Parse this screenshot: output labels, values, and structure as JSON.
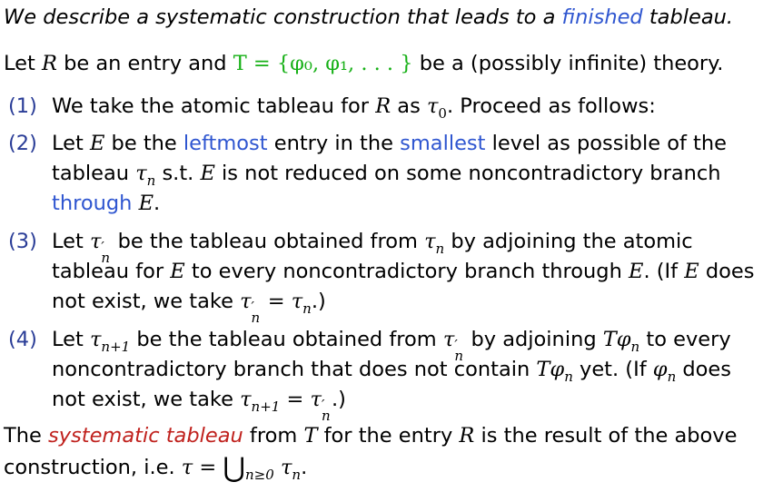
{
  "colors": {
    "text": "#000000",
    "highlight_blue": "#2f56d0",
    "highlight_green": "#16b016",
    "highlight_red": "#c0221e",
    "enum_number": "#2a3d97"
  },
  "intro": {
    "before": "We describe a systematic construction that leads to a ",
    "highlight": "finished",
    "after": " tableau."
  },
  "premise": {
    "let": "Let ",
    "entry_var": "R",
    "mid": " be an entry and ",
    "theory": "T = {φ₀, φ₁, . . . }",
    "after": " be a (possibly infinite) theory."
  },
  "steps": [
    {
      "number": "(1)",
      "text_a": "We take the atomic tableau for ",
      "var_R": "R",
      "text_b": " as ",
      "tau": "τ",
      "tau_sub": "0",
      "text_c": ". Proceed as follows:"
    },
    {
      "number": "(2)",
      "line1_a": "Let ",
      "line1_E": "E",
      "line1_b": " be the ",
      "line1_hl1": "leftmost",
      "line1_c": " entry in the ",
      "line1_hl2": "smallest",
      "line1_d": " level as possible of the",
      "line2_a": "tableau ",
      "line2_tau": "τ",
      "line2_sub": "n",
      "line2_b": " s.t. ",
      "line2_E": "E",
      "line2_c": " is not reduced on some noncontradictory branch",
      "line3_hl": "through",
      "line3_E": "E",
      "line3_end": "."
    },
    {
      "number": "(3)",
      "line1_a": "Let ",
      "line1_tau": "τ",
      "line1_prime": "′",
      "line1_sub": "n",
      "line1_b": " be the tableau obtained from ",
      "line1_tau2": "τ",
      "line1_sub2": "n",
      "line1_c": " by adjoining the atomic",
      "line2_a": "tableau for ",
      "line2_E": "E",
      "line2_b": " to every noncontradictory branch through ",
      "line2_E2": "E",
      "line2_c": ". (If ",
      "line2_E3": "E",
      "line2_d": " does",
      "line3_a": "not exist, we take ",
      "line3_tau": "τ",
      "line3_prime": "′",
      "line3_sub": "n",
      "line3_eq": " = ",
      "line3_tau2": "τ",
      "line3_sub2": "n",
      "line3_end": ".)"
    },
    {
      "number": "(4)",
      "line1_a": "Let ",
      "line1_tau": "τ",
      "line1_sub": "n+1",
      "line1_b": " be the tableau obtained from ",
      "line1_tau2": "τ",
      "line1_prime": "′",
      "line1_sub2": "n",
      "line1_c": " by adjoining ",
      "line1_T": "T",
      "line1_phi": "φ",
      "line1_phisub": "n",
      "line1_d": " to every",
      "line2_a": "noncontradictory branch that does not contain ",
      "line2_T": "T",
      "line2_phi": "φ",
      "line2_phisub": "n",
      "line2_b": " yet. (If ",
      "line2_phi2": "φ",
      "line2_phisub2": "n",
      "line2_c": " does",
      "line3_a": "not exist, we take ",
      "line3_tau": "τ",
      "line3_sub": "n+1",
      "line3_eq": " = ",
      "line3_tau2": "τ",
      "line3_prime": "′",
      "line3_sub2": "n",
      "line3_end": ".)"
    }
  ],
  "closing": {
    "the": "The ",
    "highlight": "systematic tableau",
    "a": " from ",
    "T": "T",
    "b": " for the entry ",
    "R": "R",
    "c": " is the result of the above",
    "line2_a": "construction, i.e. ",
    "tau": "τ",
    "eq": " = ",
    "union": "⋃",
    "union_sub": "n≥0",
    "tau2": "τ",
    "tau2_sub": "n",
    "end": "."
  }
}
